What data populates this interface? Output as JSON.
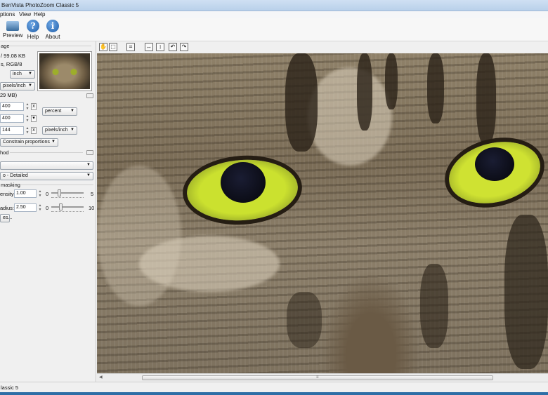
{
  "window": {
    "title": "BenVista PhotoZoom Classic 5"
  },
  "menu": {
    "items": [
      "ptions",
      "View",
      "Help"
    ]
  },
  "toolbar": {
    "buttons": [
      {
        "label": "Preview",
        "icon": "preview-icon"
      },
      {
        "label": "Help",
        "icon": "help-icon"
      },
      {
        "label": "About",
        "icon": "info-icon"
      }
    ]
  },
  "panel": {
    "section_image": "age",
    "file_size": "/ 99.08 KB",
    "color_mode": "s, RGB/8",
    "unit_select": "inch",
    "res_unit_select": "pixels/inch",
    "new_size_label": "29 MB)",
    "width_value": "400",
    "height_value": "400",
    "resolution_value": "144",
    "size_unit_select": "percent",
    "resolution_unit_select": "pixels/inch",
    "constrain_label": "Constrain proportions",
    "method_label": "hod",
    "method_select": "",
    "preset_select": "o - Detailed",
    "unsharp_label": "masking",
    "intensity_label": "ensity:",
    "intensity_value": "1.00",
    "intensity_min": "0",
    "intensity_max": "5",
    "radius_label": "adius:",
    "radius_value": "2.50",
    "radius_min": "0",
    "radius_max": "10",
    "more_button": "es..."
  },
  "status": {
    "text": "lassic 5"
  },
  "image": {
    "subject": "tabby cat face close-up with green eyes"
  },
  "colors": {
    "accent": "#3c7fc1",
    "titlebar": "#c6daf0",
    "eye": "#cbe12f"
  }
}
